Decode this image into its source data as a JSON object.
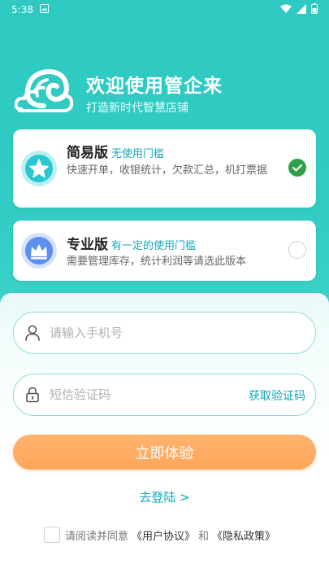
{
  "status_bar": {
    "time": "5:38"
  },
  "hero": {
    "title": "欢迎使用管企来",
    "subtitle": "打造新时代智慧店铺"
  },
  "plans": [
    {
      "title": "简易版",
      "tag": "无使用门槛",
      "description": "快速开单，收银统计，欠款汇总，机打票据",
      "selected": true
    },
    {
      "title": "专业版",
      "tag": "有一定的使用门槛",
      "description": "需要管理库存，统计利润等请选此版本",
      "selected": false
    }
  ],
  "form": {
    "phone_placeholder": "请输入手机号",
    "code_placeholder": "短信验证码",
    "get_code_label": "获取验证码",
    "submit_label": "立即体验",
    "login_link": "去登陆 >"
  },
  "agreement": {
    "prefix": "请阅读并同意",
    "user_agreement": "《用户协议》",
    "and": "和",
    "privacy_policy": "《隐私政策》"
  },
  "colors": {
    "accent": "#2ec9c1",
    "primary_button": "#ffa95e",
    "link": "#17a6b6",
    "check": "#2fa04a"
  }
}
